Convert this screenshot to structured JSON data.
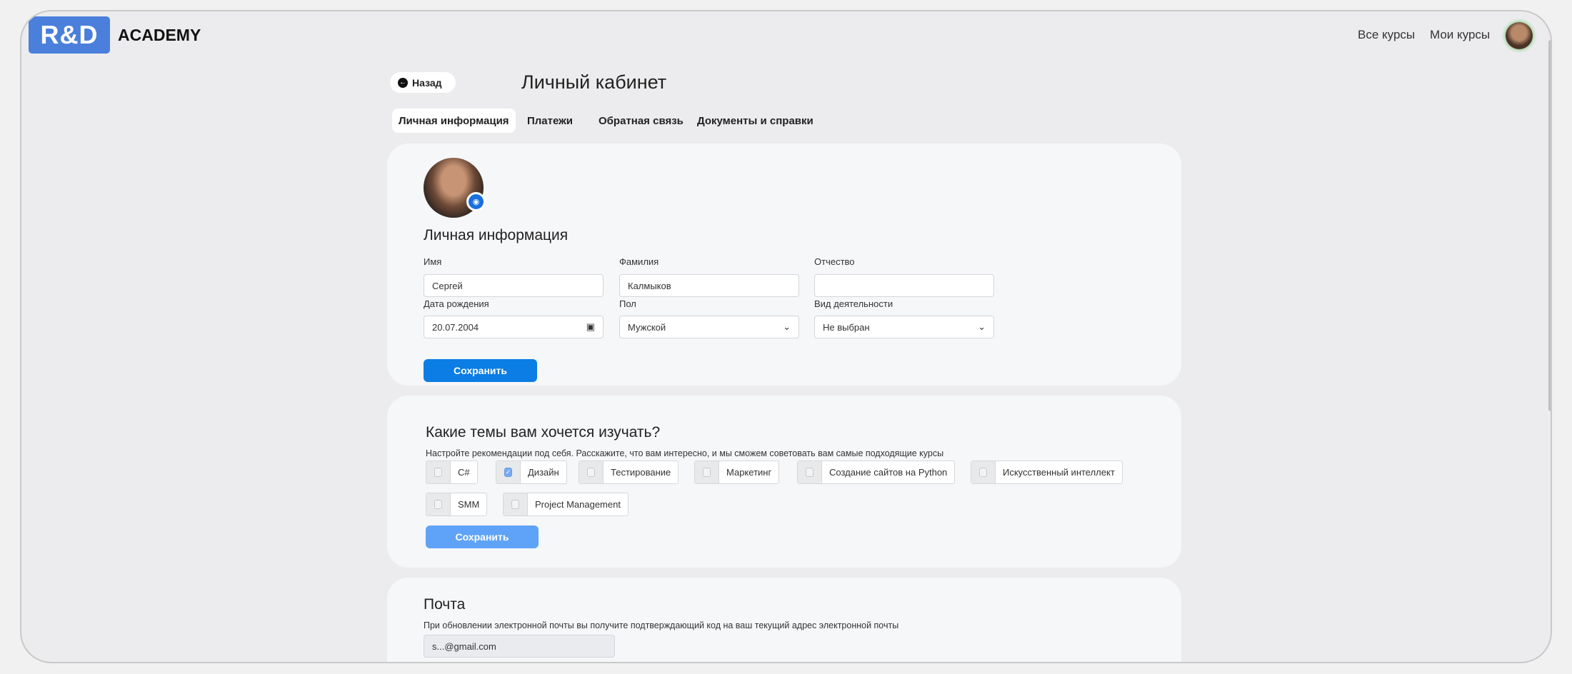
{
  "header": {
    "logo": "R&D",
    "brand": "ACADEMY",
    "nav": [
      "Все курсы",
      "Мои курсы"
    ]
  },
  "page": {
    "back": "Назад",
    "title": "Личный кабинет",
    "tabs": [
      "Личная информация",
      "Платежи",
      "Обратная связь",
      "Документы и справки"
    ]
  },
  "personal": {
    "heading": "Личная информация",
    "fields": [
      {
        "label": "Имя",
        "value": "Сергей"
      },
      {
        "label": "Фамилия",
        "value": "Калмыков"
      },
      {
        "label": "Отчество",
        "value": ""
      },
      {
        "label": "Дата рождения",
        "value": "20.07.2004"
      },
      {
        "label": "Пол",
        "value": "Мужской"
      },
      {
        "label": "Вид деятельности",
        "value": "Не выбран"
      }
    ],
    "save": "Сохранить"
  },
  "topics": {
    "heading": "Какие темы вам хочется изучать?",
    "description": "Настройте рекомендации под себя. Расскажите, что вам интересно, и мы сможем советовать вам самые подходящие курсы",
    "items": [
      {
        "label": "C#",
        "checked": false
      },
      {
        "label": "Дизайн",
        "checked": true
      },
      {
        "label": "Тестирование",
        "checked": false
      },
      {
        "label": "Маркетинг",
        "checked": false
      },
      {
        "label": "Создание сайтов на Python",
        "checked": false
      },
      {
        "label": "Искусственный интеллект",
        "checked": false
      },
      {
        "label": "SMM",
        "checked": false
      },
      {
        "label": "Project Management",
        "checked": false
      }
    ],
    "save": "Сохранить"
  },
  "email": {
    "heading": "Почта",
    "description": "При обновлении электронной почты вы получите подтверждающий код на ваш текущий адрес электронной почты",
    "value": "s...@gmail.com"
  }
}
